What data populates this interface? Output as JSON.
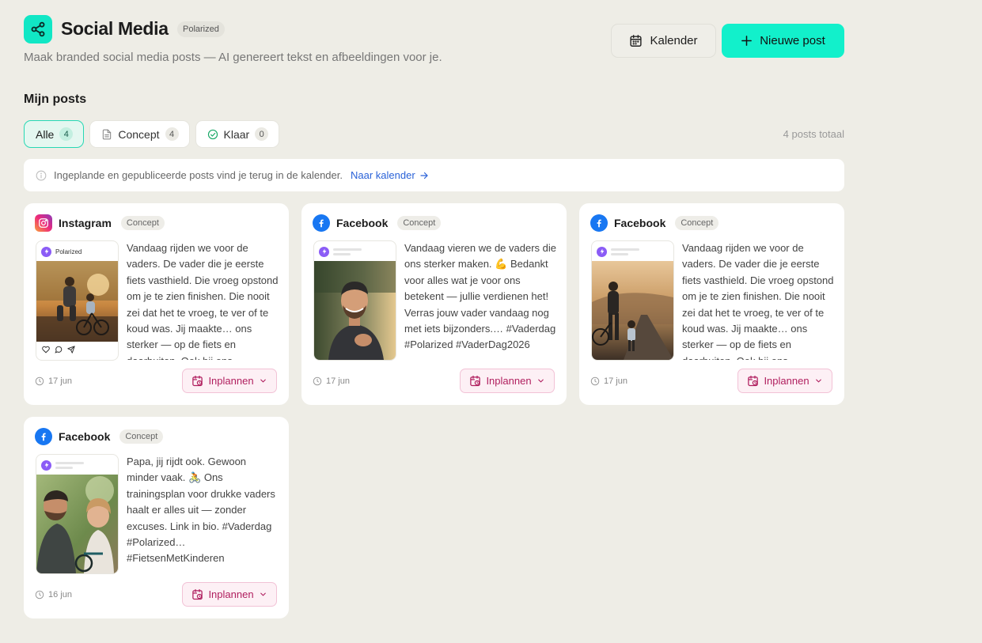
{
  "header": {
    "title": "Social Media",
    "brand_badge": "Polarized",
    "subtitle": "Maak branded social media posts — AI genereert tekst en afbeeldingen voor je.",
    "calendar_label": "Kalender",
    "new_post_label": "Nieuwe post"
  },
  "section": {
    "title": "Mijn posts"
  },
  "filters": [
    {
      "label": "Alle",
      "count": "4",
      "active": true
    },
    {
      "label": "Concept",
      "count": "4",
      "active": false
    },
    {
      "label": "Klaar",
      "count": "0",
      "active": false
    }
  ],
  "total": "4 posts totaal",
  "info": {
    "text": "Ingeplande en gepubliceerde posts vind je terug in de kalender.",
    "link": "Naar kalender"
  },
  "posts": [
    {
      "platform": "Instagram",
      "status": "Concept",
      "brand": "Polarized",
      "text": "Vandaag rijden we voor de vaders. De vader die je eerste fiets vasthield. Die vroeg opstond om je te zien finishen. Die nooit zei dat het te vroeg, te ver of te koud was. Jij maakte… ons sterker — op de fiets en daarbuiten. Ook bij ons",
      "date": "17 jun",
      "action": "Inplannen"
    },
    {
      "platform": "Facebook",
      "status": "Concept",
      "text": "Vandaag vieren we de vaders die ons sterker maken. 💪 Bedankt voor alles wat je voor ons betekent — jullie verdienen het! Verras jouw vader vandaag nog met iets bijzonders.… #Vaderdag #Polarized #VaderDag2026",
      "date": "17 jun",
      "action": "Inplannen"
    },
    {
      "platform": "Facebook",
      "status": "Concept",
      "text": "Vandaag rijden we voor de vaders. De vader die je eerste fiets vasthield. Die vroeg opstond om je te zien finishen. Die nooit zei dat het te vroeg, te ver of te koud was. Jij maakte… ons sterker — op de fiets en daarbuiten. Ook bij ons",
      "date": "17 jun",
      "action": "Inplannen"
    },
    {
      "platform": "Facebook",
      "status": "Concept",
      "text": "Papa, jij rijdt ook. Gewoon minder vaak. 🚴 Ons trainingsplan voor drukke vaders haalt er alles uit — zonder excuses. Link in bio. #Vaderdag #Polarized… #FietsenMetKinderen",
      "date": "16 jun",
      "action": "Inplannen"
    }
  ],
  "colors": {
    "accent": "#12f0cb",
    "background": "#eeede6",
    "schedule_pink": "#b01e5e",
    "link_blue": "#2a62d8"
  },
  "icons": {
    "app": "share-icon",
    "calendar": "calendar-icon",
    "new": "plus-icon",
    "info": "info-icon"
  }
}
